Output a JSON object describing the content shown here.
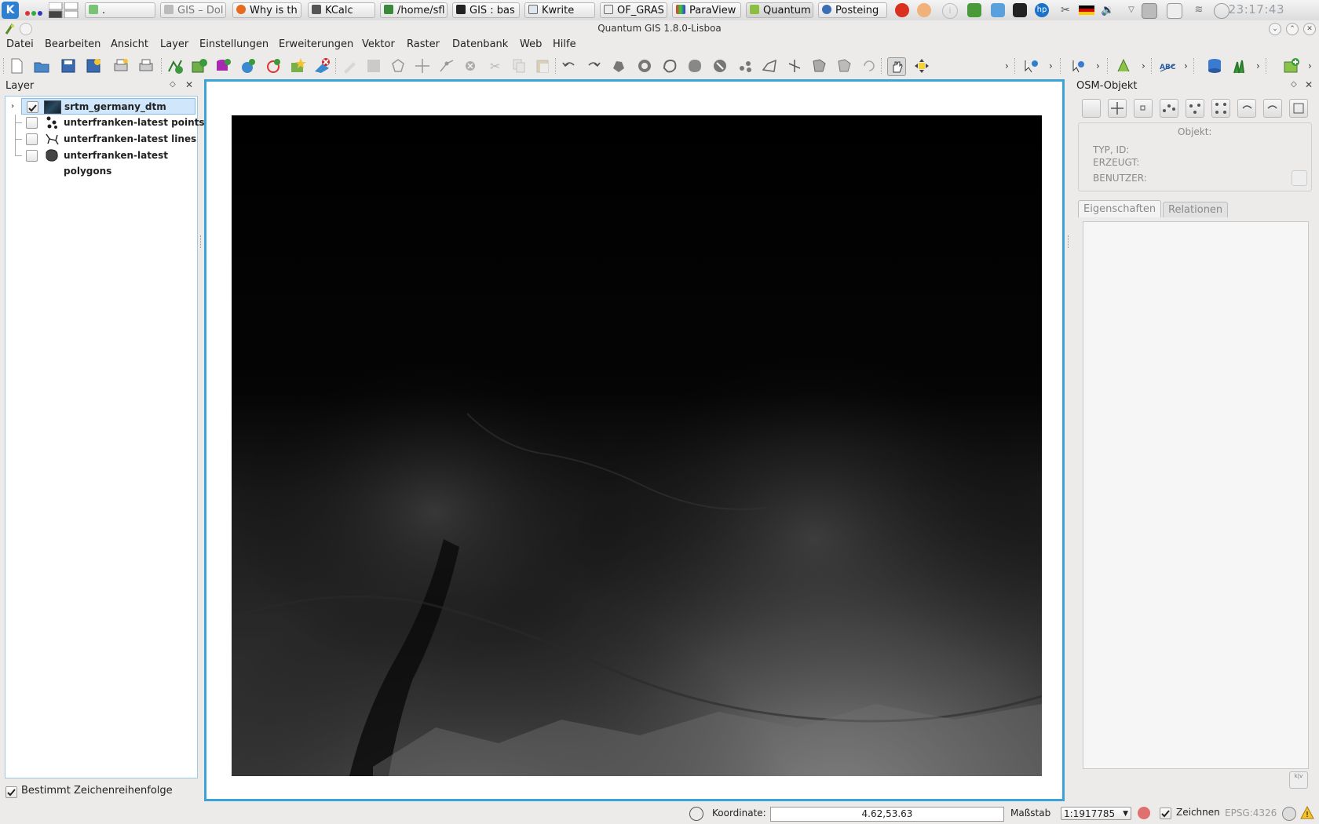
{
  "taskbar": {
    "tasks": [
      {
        "label": "."
      },
      {
        "label": "GIS – Dol"
      },
      {
        "label": "Why is th"
      },
      {
        "label": "KCalc"
      },
      {
        "label": "/home/sfl"
      },
      {
        "label": "GIS : bas"
      },
      {
        "label": "Kwrite"
      },
      {
        "label": "OF_GRAS"
      },
      {
        "label": "ParaView"
      },
      {
        "label": "Quantum"
      },
      {
        "label": "Posteing"
      }
    ],
    "clock": "23:17:43",
    "tray_icons": [
      "tomato-icon",
      "balloon-icon",
      "info-icon",
      "network-app-icon",
      "dropbox-icon",
      "display-icon",
      "hp-icon",
      "scissors-icon",
      "german-flag-icon",
      "volume-icon",
      "chevron-icon",
      "hdd-icon",
      "clipboard-icon",
      "wifi-icon",
      "power-icon"
    ]
  },
  "window": {
    "title": "Quantum GIS 1.8.0-Lisboa"
  },
  "menubar": {
    "items": [
      "Datei",
      "Bearbeiten",
      "Ansicht",
      "Layer",
      "Einstellungen",
      "Erweiterungen",
      "Vektor",
      "Raster",
      "Datenbank",
      "Web",
      "Hilfe"
    ]
  },
  "layers_panel": {
    "title": "Layer",
    "layers": [
      {
        "name": "srtm_germany_dtm",
        "checked": true,
        "icon": "raster-icon"
      },
      {
        "name": "unterfranken-latest points",
        "checked": false,
        "icon": "points-icon"
      },
      {
        "name": "unterfranken-latest lines",
        "checked": false,
        "icon": "lines-icon"
      },
      {
        "name": "unterfranken-latest polygons",
        "checked": false,
        "icon": "polygons-icon"
      }
    ],
    "render_order_label": "Bestimmt Zeichenreihenfolge",
    "render_order_checked": true
  },
  "osm_panel": {
    "title": "OSM-Objekt",
    "object_label": "Objekt:",
    "type_id_label": "TYP, ID:",
    "created_label": "ERZEUGT:",
    "user_label": "BENUTZER:",
    "tabs": [
      "Eigenschaften",
      "Relationen"
    ]
  },
  "statusbar": {
    "coord_label": "Koordinate:",
    "coord_value": "4.62,53.63",
    "scale_label": "Maßstab",
    "scale_value": "1:1917785",
    "render_label": "Zeichnen",
    "render_checked": true,
    "crs": "EPSG:4326"
  }
}
